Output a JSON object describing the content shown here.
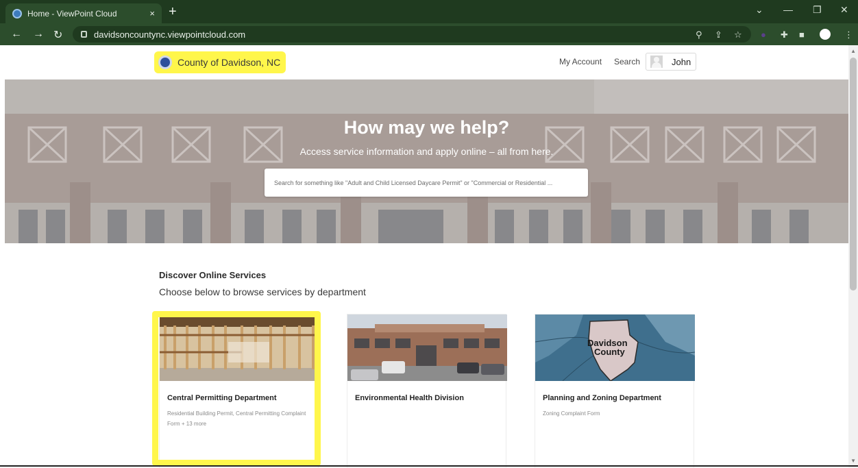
{
  "browser": {
    "tab_title": "Home - ViewPoint Cloud",
    "tab_close": "×",
    "new_tab": "+",
    "url": "davidsoncountync.viewpointcloud.com",
    "icons": [
      "favicon",
      "back-icon",
      "forward-icon",
      "reload-icon",
      "lock-icon",
      "zoom-icon",
      "share-icon",
      "star-icon",
      "extension-icon",
      "puzzle-icon",
      "sidebar-icon",
      "profile-icon",
      "menu-icon",
      "minimize-icon",
      "restore-icon",
      "close-icon",
      "tab-list-icon"
    ]
  },
  "header": {
    "brand": "County of Davidson, NC",
    "my_account": "My Account",
    "search": "Search",
    "user": "John"
  },
  "hero": {
    "title": "How may we help?",
    "subtitle": "Access service information and apply online – all from here.",
    "search_placeholder": "Search for something like \"Adult and Child Licensed Daycare Permit\" or \"Commercial or Residential ..."
  },
  "services": {
    "title": "Discover Online Services",
    "subtitle": "Choose below to browse services by department",
    "cards": [
      {
        "title": "Central Permitting Department",
        "description": "Residential Building Permit, Central Permitting Complaint Form + 13 more"
      },
      {
        "title": "Environmental Health Division",
        "description": ""
      },
      {
        "title": "Planning and Zoning Department",
        "description": "Zoning Complaint Form",
        "map_label_1": "Davidson",
        "map_label_2": "County"
      }
    ]
  },
  "colors": {
    "chrome_dark": "#1f3a1f",
    "chrome_mid": "#2c4d2c",
    "highlight": "#fff64b"
  }
}
